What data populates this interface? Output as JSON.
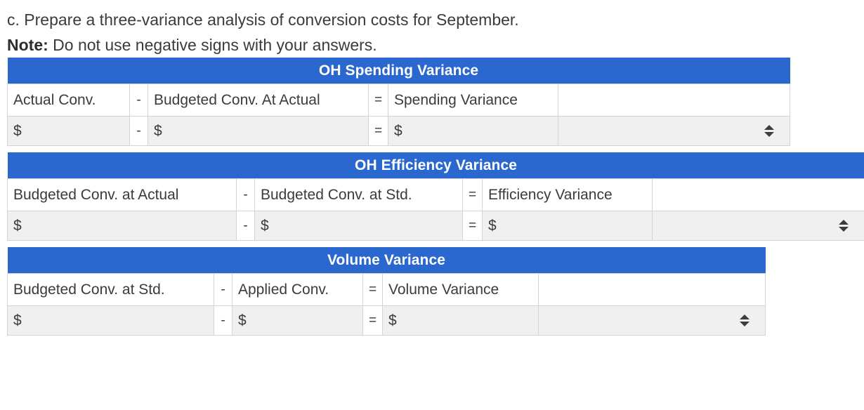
{
  "colors": {
    "header_blue": "#2a68cf",
    "input_gray": "#f0f0f0",
    "border_gray": "#d4d4d4",
    "text": "#3b3b3b"
  },
  "intro": {
    "question": "c. Prepare a three-variance analysis of conversion costs for September.",
    "note_label": "Note:",
    "note_text": " Do not use negative signs with your answers."
  },
  "tables": [
    {
      "title": "OH Spending Variance",
      "headers": {
        "term1": "Actual Conv.",
        "op1": "-",
        "term2": "Budgeted Conv. At Actual",
        "op2": "=",
        "result": "Spending Variance",
        "select_header": ""
      },
      "values": {
        "term1": "$",
        "op1": "-",
        "term2": "$",
        "op2": "=",
        "result": "$",
        "select_value": ""
      },
      "select_icon": "up-down-arrows-icon"
    },
    {
      "title": "OH Efficiency Variance",
      "headers": {
        "term1": "Budgeted Conv. at Actual",
        "op1": "-",
        "term2": "Budgeted Conv. at Std.",
        "op2": "=",
        "result": "Efficiency Variance",
        "select_header": ""
      },
      "values": {
        "term1": "$",
        "op1": "-",
        "term2": "$",
        "op2": "=",
        "result": "$",
        "select_value": ""
      },
      "select_icon": "up-down-arrows-icon"
    },
    {
      "title": "Volume Variance",
      "headers": {
        "term1": "Budgeted Conv. at Std.",
        "op1": "-",
        "term2": "Applied Conv.",
        "op2": "=",
        "result": "Volume Variance",
        "select_header": ""
      },
      "values": {
        "term1": "$",
        "op1": "-",
        "term2": "$",
        "op2": "=",
        "result": "$",
        "select_value": ""
      },
      "select_icon": "up-down-arrows-icon"
    }
  ]
}
